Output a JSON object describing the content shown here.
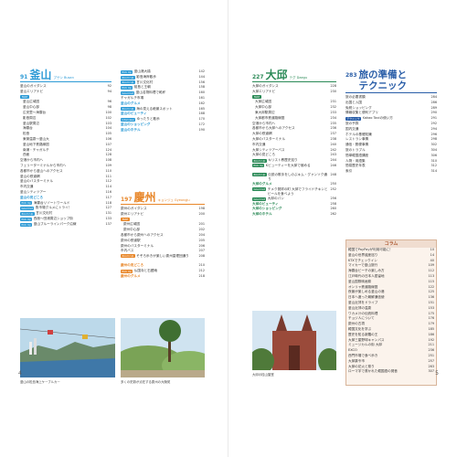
{
  "colors": {
    "busan": "#2e9bd6",
    "gyeongju": "#e8872a",
    "daegu": "#2b8a57",
    "guide": "#2a5ea8",
    "column": "#b0603a"
  },
  "left": {
    "page_number": "4",
    "busan": {
      "num": "91",
      "title": "釜山",
      "sub": "プサン Busan",
      "rows": [
        {
          "t": "釜山のガイダンス",
          "p": "92"
        },
        {
          "t": "釜山エリアナビ",
          "p": "94"
        },
        {
          "t": "MAP",
          "p": "",
          "badge": true
        },
        {
          "t": "釜山広域図",
          "p": "96",
          "sub": true
        },
        {
          "t": "釜山中心部",
          "p": "98",
          "sub": true
        },
        {
          "t": "広安里～海雲台",
          "p": "100",
          "sub": true
        },
        {
          "t": "影島周辺",
          "p": "102",
          "sub": true
        },
        {
          "t": "釜山駅周辺",
          "p": "103",
          "sub": true
        },
        {
          "t": "海雲台",
          "p": "104",
          "sub": true
        },
        {
          "t": "松島",
          "p": "105",
          "sub": true
        },
        {
          "t": "東萊温泉～釜山大",
          "p": "106",
          "sub": true
        },
        {
          "t": "釜山地下鉄路線図",
          "p": "107",
          "sub": true
        },
        {
          "t": "南浦・チャガルチ",
          "p": "124",
          "sub": true
        },
        {
          "t": "西面",
          "p": "128",
          "sub": true
        },
        {
          "t": "空港から市内へ",
          "p": "108"
        },
        {
          "t": "フェリーターミナルから市内へ",
          "p": "109"
        },
        {
          "t": "各都市から釜山へのアクセス",
          "p": "110"
        },
        {
          "t": "釜山の鉄道網",
          "p": "111"
        },
        {
          "t": "釜山のバスターミナル",
          "p": "112"
        },
        {
          "t": "市内交通",
          "p": "114"
        },
        {
          "t": "釜山シティツアー",
          "p": "116"
        },
        {
          "t": "釜山の見どころ",
          "p": "117",
          "bold": true
        },
        {
          "t": "海雲台リゾートワールド",
          "p": "118",
          "tag": "Pick Up"
        },
        {
          "t": "魚市場グルメにトライ！",
          "p": "127",
          "tag": "Gourmet"
        },
        {
          "t": "甘川文化村",
          "p": "131",
          "tag": "Zoom Up"
        },
        {
          "t": "西面〜田浦周辺ショップ街",
          "p": "133",
          "tag": "Pick Up"
        },
        {
          "t": "釜山ブルーラインパーク沿線",
          "p": "137",
          "tag": "Pick Up"
        }
      ],
      "caption": "釜山の松島海上ケーブルカー"
    },
    "busan2": {
      "rows": [
        {
          "t": "釜山港大橋",
          "p": "142",
          "tag": "Pick Up"
        },
        {
          "t": "影島海岸散歩",
          "p": "144",
          "tag": "Zoom Up"
        },
        {
          "t": "甘川文化村",
          "p": "156",
          "tag": "Zoom Up"
        },
        {
          "t": "桜島と王朝",
          "p": "158",
          "tag": "Pick Up"
        },
        {
          "t": "釜山名物料理で乾杯",
          "p": "160",
          "tag": "Gourmet"
        },
        {
          "t": "チャガルチ市場",
          "p": "161"
        },
        {
          "t": "釜山のグルメ",
          "p": "162",
          "bold": true
        },
        {
          "t": "海の見える絶景スポット",
          "p": "165",
          "tag": "Zoom Up"
        },
        {
          "t": "釜山のビューティ",
          "p": "168",
          "bold": true
        },
        {
          "t": "ゆったりと散歩",
          "p": "170",
          "tag": "Interview"
        },
        {
          "t": "釜山のショッピング",
          "p": "172",
          "bold": true
        },
        {
          "t": "釜山のホテル",
          "p": "190",
          "bold": true
        }
      ]
    },
    "gyeongju": {
      "num": "197",
      "title": "慶州",
      "sub": "キョンジュ Gyeongju",
      "rows": [
        {
          "t": "慶州のガイダンス",
          "p": "198"
        },
        {
          "t": "慶州エリアナビ",
          "p": "200"
        },
        {
          "t": "MAP",
          "p": "",
          "badge": true
        },
        {
          "t": "慶州広域図",
          "p": "201",
          "sub": true
        },
        {
          "t": "慶州中心部",
          "p": "202",
          "sub": true
        },
        {
          "t": "各都市から慶州へのアクセス",
          "p": "204"
        },
        {
          "t": "慶州の鉄道駅",
          "p": "205"
        },
        {
          "t": "慶州のバスターミナル",
          "p": "206"
        },
        {
          "t": "市内バス",
          "p": "207"
        },
        {
          "t": "そぞろ歩きが楽しい慶州皇理団通り",
          "p": "208",
          "tag": "Zoom Up",
          "two": true
        },
        {
          "t": "慶州の見どころ",
          "p": "210",
          "bold": true
        },
        {
          "t": "仏国寺と石窟庵",
          "p": "212",
          "tag": "Pick Up"
        },
        {
          "t": "慶州のグルメ",
          "p": "218",
          "bold": true
        }
      ],
      "caption": "多くの史跡が点在する慶州の大陵苑"
    }
  },
  "right": {
    "page_number": "5",
    "daegu": {
      "num": "227",
      "title": "大邱",
      "sub": "テグ Daegu",
      "rows": [
        {
          "t": "大邱のガイダンス",
          "p": "228"
        },
        {
          "t": "大邱エリアナビ",
          "p": "230"
        },
        {
          "t": "MAP",
          "p": "",
          "badge": true
        },
        {
          "t": "大邱広域図",
          "p": "231",
          "sub": true
        },
        {
          "t": "大邱中心部",
          "p": "232",
          "sub": true
        },
        {
          "t": "東大邱駅周辺",
          "p": "233",
          "sub": true
        },
        {
          "t": "大邱都市鉄道路線図",
          "p": "234",
          "sub": true
        },
        {
          "t": "空港から市内へ",
          "p": "235"
        },
        {
          "t": "各都市から大邱へのアクセス",
          "p": "236"
        },
        {
          "t": "大邱の鉄道網",
          "p": "237"
        },
        {
          "t": "大邱のバスターミナル",
          "p": "238"
        },
        {
          "t": "市内交通",
          "p": "240"
        },
        {
          "t": "大邱シティツアーバス",
          "p": "242"
        },
        {
          "t": "大邱の見どころ",
          "p": "243"
        },
        {
          "t": "キリスト教歴史巡り",
          "p": "244",
          "tag": "Zoom Up"
        },
        {
          "t": "Kビューティーを大邱で極める",
          "p": "246",
          "tag": "Pick Up",
          "two": true
        },
        {
          "t": "伝説の歌手をしのぶキム・グァンソク通り",
          "p": "248",
          "tag": "Zoom Up",
          "two": true
        },
        {
          "t": "大邱のグルメ",
          "p": "250",
          "bold": true
        },
        {
          "t": "チメク発祥の町 大邱でフライドチキンとビールを食べよう",
          "p": "252",
          "tag": "Gourmet",
          "two": true
        },
        {
          "t": "大邱のパン",
          "p": "256",
          "tag": "Gourmet"
        },
        {
          "t": "大邱のビューティ",
          "p": "258",
          "bold": true
        },
        {
          "t": "大邱のショッピング",
          "p": "260",
          "bold": true
        },
        {
          "t": "大邱のホテル",
          "p": "262",
          "bold": true
        }
      ],
      "caption": "大邱の桂山聖堂"
    },
    "guide": {
      "num": "283",
      "title": "旅の準備と\nテクニック",
      "rows": [
        {
          "t": "旅の必要書類",
          "p": "284"
        },
        {
          "t": "出国と入国",
          "p": "286"
        },
        {
          "t": "免税ショッピング",
          "p": "289"
        },
        {
          "t": "情報収集と便利アプリ",
          "p": "290"
        },
        {
          "t": "Kakao Taxiの使い方",
          "p": "291",
          "tag": "テクニック"
        },
        {
          "t": "旅の予算",
          "p": "292"
        },
        {
          "t": "国内交通",
          "p": "294"
        },
        {
          "t": "ホテルの基礎知識",
          "p": "296"
        },
        {
          "t": "レストラン事情",
          "p": "298"
        },
        {
          "t": "通信・郵便事情",
          "p": "302"
        },
        {
          "t": "旅のトラブル",
          "p": "304"
        },
        {
          "t": "簡単韓国語講座",
          "p": "306"
        },
        {
          "t": "人物・用語集",
          "p": "310"
        },
        {
          "t": "簡易歴史年表",
          "p": "312"
        },
        {
          "t": "索引",
          "p": "314"
        }
      ]
    },
    "column": {
      "head": "コラム",
      "rows": [
        {
          "t": "韓国でPayPayが利用可能に！",
          "p": "10"
        },
        {
          "t": "釜山の世界遺産巡り",
          "p": "14"
        },
        {
          "t": "KTXでチェックイン",
          "p": "40"
        },
        {
          "t": "マイカーで釜山旅行",
          "p": "109"
        },
        {
          "t": "海雲台ビーチの楽しみ方",
          "p": "112"
        },
        {
          "t": "江戸時代の日本人居留地",
          "p": "113"
        },
        {
          "t": "釜山国際映画祭",
          "p": "115"
        },
        {
          "t": "オンリャ鉄道路線図",
          "p": "122"
        },
        {
          "t": "夜景が楽しめる釜山の港",
          "p": "125"
        },
        {
          "t": "日本へ渡った朝鮮通信使",
          "p": "136"
        },
        {
          "t": "釜山近郊をドライブ",
          "p": "151"
        },
        {
          "t": "釜山近郊の温泉",
          "p": "153"
        },
        {
          "t": "ワカメ汁の伝統料理",
          "p": "175"
        },
        {
          "t": "チョジ人について",
          "p": "176"
        },
        {
          "t": "慶州の古墳",
          "p": "179"
        },
        {
          "t": "韓国文化を学ぶ",
          "p": "185"
        },
        {
          "t": "歴史を知る新羅の王",
          "p": "186"
        },
        {
          "t": "大邱三星野球キャンパス",
          "p": "192"
        },
        {
          "t": "ミュージカルの街 大邱",
          "p": "211"
        },
        {
          "t": "EXCO",
          "p": "236"
        },
        {
          "t": "西門市場で食べ歩き",
          "p": "251"
        },
        {
          "t": "大邱薬令市",
          "p": "257"
        },
        {
          "t": "大邱の花火と祭り",
          "p": "263"
        },
        {
          "t": "ローマ字で書かれた韓国語の発音",
          "p": "307"
        }
      ]
    }
  }
}
